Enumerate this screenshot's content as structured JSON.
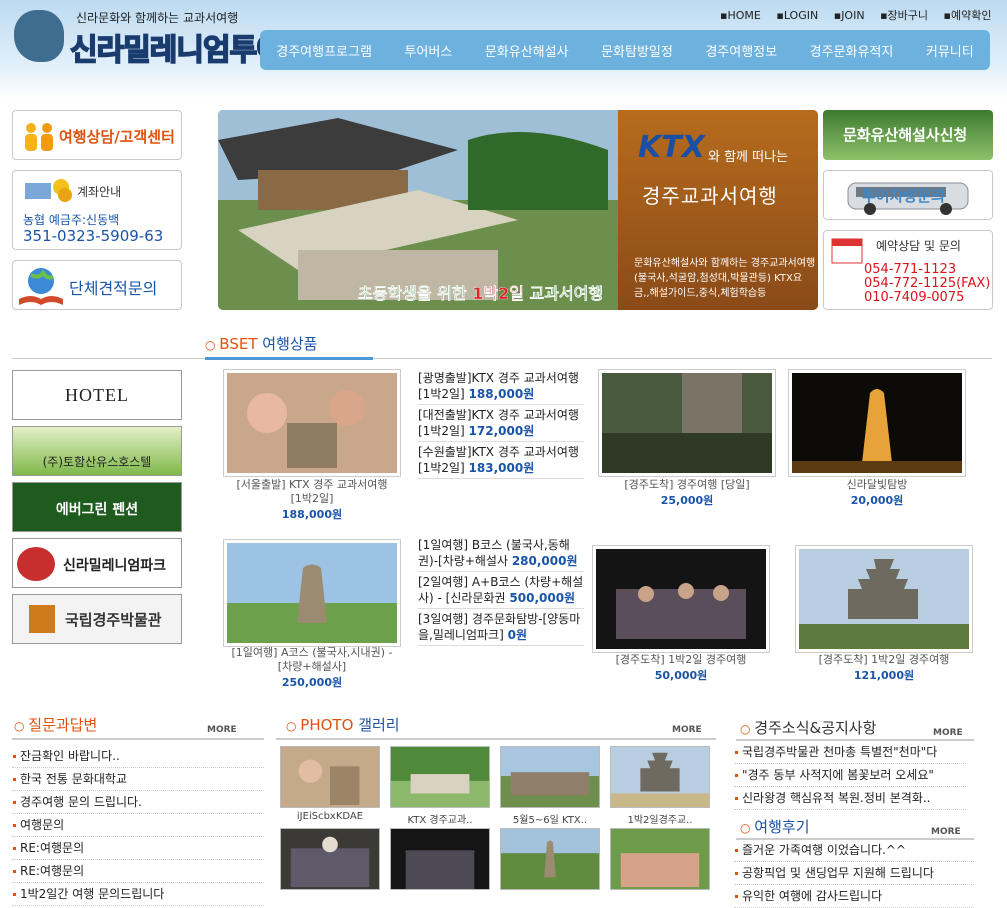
{
  "header": {
    "slogan": "신라문화와 함께하는 교과서여행",
    "brand": "신라밀레니엄투어",
    "top_links": [
      "HOME",
      "LOGIN",
      "JOIN",
      "장바구니",
      "예약확인"
    ],
    "nav": [
      "경주여행프로그램",
      "투어버스",
      "문화유산해설사",
      "문화탐방일정",
      "경주여행정보",
      "경주문화유적지",
      "커뮤니티"
    ]
  },
  "left": {
    "counsel": "여행상담/고객센터",
    "bank_title": "계좌안내",
    "bank_info": "농협 예금주:신동백",
    "bank_number": "351-0323-5909-63",
    "group": "단체견적문의"
  },
  "banner": {
    "ktx": "KTX",
    "with": "와 함께 떠나는",
    "title": "경주교과서여행",
    "desc": "문화유산해설사와 함께하는 경주교과서여행(불국사,석굴암,첨성대,박물관등) KTX요금,,해설가이드,중식,체험학습등",
    "tag_a": "초등학생을 위한 ",
    "tag_b": "1박2일",
    "tag_c": " 교과서여행"
  },
  "right": {
    "guide_apply": "문화유산해설사신청",
    "bus_inquiry": "투어차량문의",
    "resv_title": "예약상담 및 문의",
    "phones": [
      "054-771-1123",
      "054-772-1125(FAX)",
      "010-7409-0075"
    ]
  },
  "best": {
    "label": "BSET",
    "title": "여행상품"
  },
  "partners": [
    "HOTEL CONCORDE",
    "(주)토함산유스호스텔",
    "에버그린 펜션",
    "신라밀레니엄파크",
    "국립경주박물관"
  ],
  "products_row1": {
    "main": {
      "caption": "[서울출발] KTX 경주 교과서여행\n[1박2일]",
      "price": "188,000원"
    },
    "list": [
      {
        "text": "[광명출발]KTX 경주 교과서여행 [1박2일] ",
        "price": "188,000원"
      },
      {
        "text": "[대전출발]KTX 경주 교과서여행 [1박2일] ",
        "price": "172,000원"
      },
      {
        "text": "[수원출발]KTX 경주 교과서여행 [1박2일] ",
        "price": "183,000원"
      }
    ],
    "p2": {
      "caption": "[경주도착] 경주여행 [당일]",
      "price": "25,000원"
    },
    "p3": {
      "caption": "신라달빛탐방",
      "price": "20,000원"
    }
  },
  "products_row2": {
    "main": {
      "caption": "[1일여행] A코스 (불국사,시내권) - [차량+해설사]",
      "price": "250,000원"
    },
    "list": [
      {
        "text": "[1일여행] B코스 (불국사,동해권)-[차량+해설사 ",
        "price": "280,000원"
      },
      {
        "text": "[2일여행] A+B코스 (차량+해설사) - [신라문화권 ",
        "price": "500,000원"
      },
      {
        "text": "[3일여행] 경주문화탐방-[양동마을,밀레니엄파크] ",
        "price": "0원"
      }
    ],
    "p2": {
      "caption": "[경주도착] 1박2일 경주여행",
      "price": "50,000원"
    },
    "p3": {
      "caption": "[경주도착] 1박2일 경주여행",
      "price": "121,000원"
    }
  },
  "qna": {
    "title_a": "질문과답변",
    "more": "MORE",
    "items": [
      "잔금확인 바랍니다..",
      "한국 전통 문화대학교",
      "경주여행 문의 드립니다.",
      "여행문의",
      "RE:여행문의",
      "RE:여행문의",
      "1박2일간 여행 문의드립니다"
    ]
  },
  "gallery": {
    "title_a": "PHOTO",
    "title_b": "갤러리",
    "more": "MORE",
    "captions": [
      "iJEiScbxKDAE",
      "KTX 경주교과..",
      "5월5~6일 KTX..",
      "1박2일경주교.."
    ]
  },
  "news": {
    "title": "경주소식&공지사항",
    "more": "MORE",
    "items": [
      "국립경주박물관 천마총 특별전\"천마\"다",
      "\"경주 동부 사적지에 봄꽃보러 오세요\"",
      "신라왕경 핵심유적 복원.정비 본격화.."
    ]
  },
  "review": {
    "title": "여행후기",
    "more": "MORE",
    "items": [
      "즐거운 가족여행 이었습니다.^^",
      "공항픽업 및 샌딩업무 지원해 드립니다",
      "유익한 여행에 감사드립니다"
    ]
  }
}
